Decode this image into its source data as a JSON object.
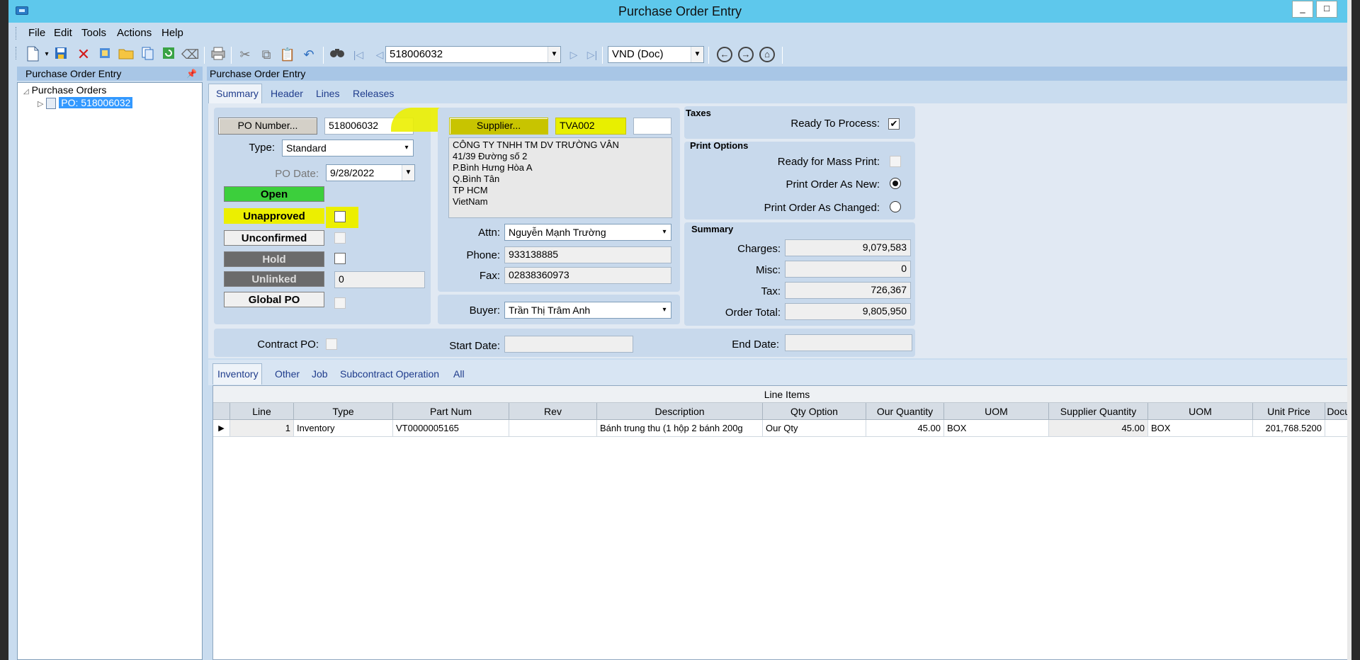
{
  "window": {
    "title": "Purchase Order Entry",
    "min_label": "_",
    "max_label": "□"
  },
  "menu": [
    "File",
    "Edit",
    "Tools",
    "Actions",
    "Help"
  ],
  "toolbar": {
    "record_combo": "518006032",
    "currency_combo": "VND (Doc)",
    "icons": [
      "new-icon",
      "save-icon",
      "delete-icon",
      "attach-icon",
      "open-folder-icon",
      "copy-icon",
      "refresh-icon",
      "eraser-icon",
      "print-icon",
      "cut-icon",
      "copy-icon",
      "paste-icon",
      "undo-icon",
      "find-icon",
      "first-icon",
      "prev-icon",
      "next-icon",
      "last-icon",
      "back-icon",
      "forward-icon",
      "home-icon"
    ]
  },
  "left_panel": {
    "header": "Purchase Order Entry",
    "tree_root": "Purchase Orders",
    "tree_node": "PO: 518006032"
  },
  "main_header": "Purchase Order Entry",
  "tabs": [
    "Summary",
    "Header",
    "Lines",
    "Releases"
  ],
  "po": {
    "po_number_button": "PO Number...",
    "po_number": "518006032",
    "type_label": "Type:",
    "type_value": "Standard",
    "po_date_label": "PO Date:",
    "po_date": "9/28/2022",
    "status": {
      "open": "Open",
      "unapproved": "Unapproved",
      "unconfirmed": "Unconfirmed",
      "hold": "Hold",
      "unlinked": "Unlinked",
      "unlinked_value": "0",
      "global_po": "Global PO"
    },
    "contract_po_label": "Contract PO:",
    "start_date_label": "Start Date:",
    "start_date": "",
    "end_date_label": "End Date:",
    "end_date": ""
  },
  "supplier": {
    "button": "Supplier...",
    "id": "TVA002",
    "address": [
      "CÔNG TY TNHH TM DV TRƯỜNG VÂN",
      "41/39 Đường số 2",
      "P.Bình Hưng Hòa A",
      "Q.Bình Tân",
      "TP HCM",
      "VietNam"
    ],
    "attn_label": "Attn:",
    "attn": "Nguyễn Mạnh Trường",
    "phone_label": "Phone:",
    "phone": "933138885",
    "fax_label": "Fax:",
    "fax": "02838360973",
    "buyer_label": "Buyer:",
    "buyer": "Trần Thị Trâm Anh"
  },
  "taxes": {
    "title": "Taxes",
    "ready_label": "Ready To Process:",
    "ready": true
  },
  "print_options": {
    "title": "Print Options",
    "mass_label": "Ready for Mass Print:",
    "as_new_label": "Print Order As New:",
    "as_changed_label": "Print Order As Changed:"
  },
  "summary": {
    "title": "Summary",
    "charges_label": "Charges:",
    "charges": "9,079,583",
    "misc_label": "Misc:",
    "misc": "0",
    "tax_label": "Tax:",
    "tax": "726,367",
    "total_label": "Order Total:",
    "total": "9,805,950"
  },
  "subtabs": [
    "Inventory",
    "Other",
    "Job",
    "Subcontract Operation",
    "All"
  ],
  "grid": {
    "title": "Line Items",
    "columns": [
      "Line",
      "Type",
      "Part Num",
      "Rev",
      "Description",
      "Qty Option",
      "Our Quantity",
      "UOM",
      "Supplier Quantity",
      "UOM",
      "Unit Price",
      "Docum"
    ],
    "rows": [
      [
        "1",
        "Inventory",
        "VT0000005165",
        "",
        "Bánh trung thu (1 hộp 2 bánh 200g",
        "Our Qty",
        "45.00",
        "BOX",
        "45.00",
        "BOX",
        "201,768.5200",
        ""
      ]
    ]
  }
}
